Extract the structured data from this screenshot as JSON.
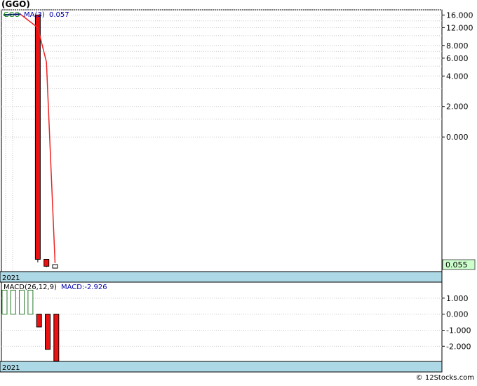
{
  "title": "(GGO)",
  "watermark": "© 12Stocks.com",
  "colors": {
    "down": "#ee1111",
    "up": "#ffffff",
    "ma": "#ee2222",
    "ohlc": "#000080",
    "grid": "#c8c8c8",
    "axis_band": "#add8e6",
    "last_box": "#ccffcc",
    "macd_pos": "#2a7a2a",
    "legend_green": "#008000",
    "legend_blue": "#0000aa"
  },
  "chart_data": [
    {
      "type": "candlestick",
      "scale": "log",
      "legend": {
        "symbol": "GGO",
        "ma_label": "MA(3)",
        "ma_value": "0.057"
      },
      "yticks": [
        "16.000",
        "12.000",
        "8.000",
        "6.000",
        "4.000",
        "2.000",
        "0.000"
      ],
      "ytick_values": [
        16,
        12,
        8,
        6,
        4,
        2,
        1
      ],
      "ylim": [
        0.05,
        18
      ],
      "last_value": "0.055",
      "last_value_numeric": 0.055,
      "x_label": "2021",
      "pre_history": [
        16,
        16.2,
        16.3
      ],
      "candles": [
        {
          "open": 16.0,
          "close": 0.062,
          "low": 0.058,
          "color": "down"
        },
        {
          "open": 0.062,
          "close": 0.053,
          "low": 0.052,
          "color": "down"
        },
        {
          "open": 0.053,
          "close": 0.055,
          "low": 0.051,
          "color": "up"
        }
      ],
      "ma": [
        16.2,
        12.0,
        5.5,
        0.057
      ]
    },
    {
      "type": "bar",
      "legend": {
        "label": "MACD(26,12,9)",
        "value_label": "MACD:-2.926"
      },
      "yticks": [
        "1.000",
        "0.000",
        "-1.000",
        "-2.000"
      ],
      "ytick_values": [
        1,
        0,
        -1,
        -2
      ],
      "ylim": [
        -2.95,
        2.0
      ],
      "x_label": "2021",
      "values": [
        1.5,
        1.5,
        1.5,
        1.5,
        -0.8,
        -2.2,
        -2.926
      ]
    }
  ]
}
